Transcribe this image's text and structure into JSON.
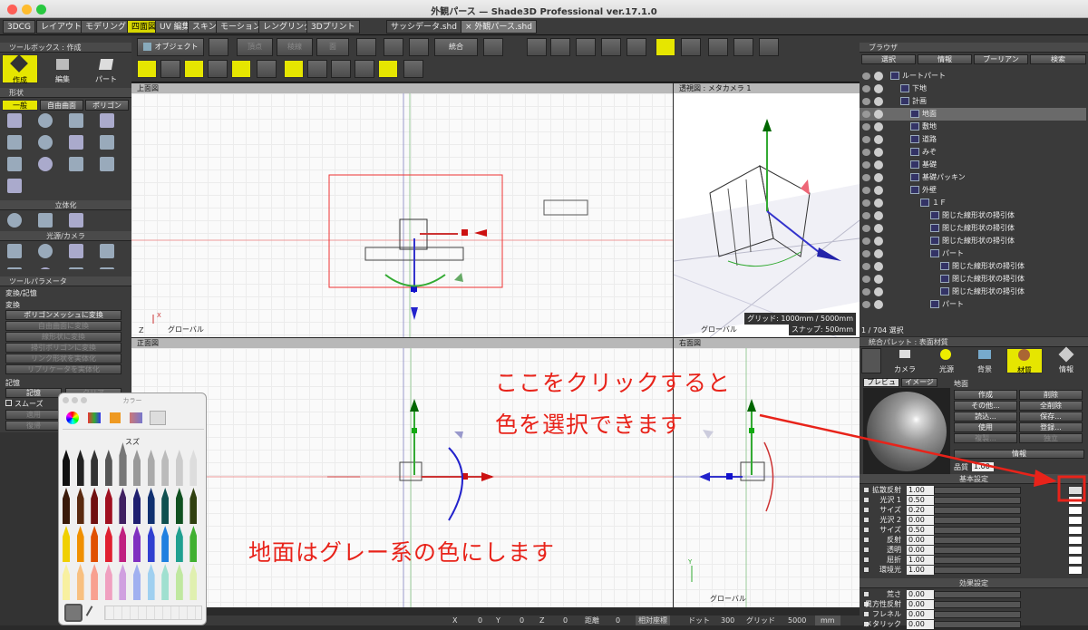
{
  "window": {
    "title": "外観パース — Shade3D Professional ver.17.1.0"
  },
  "modes": [
    "3DCG",
    "レイアウト",
    "モデリング",
    "四面図",
    "UV 編集",
    "スキン",
    "モーション",
    "レングリング",
    "3Dプリント"
  ],
  "doc_tabs": [
    "サッシデータ.shd",
    "× 外観パース.shd"
  ],
  "toolbox": {
    "header": "ツールボックス : 作成",
    "tabs": [
      "作成",
      "編集",
      "パート"
    ],
    "shape_label": "形状",
    "shape_tabs": [
      "一般",
      "自由曲面",
      "ポリゴン"
    ],
    "solidify_label": "立体化",
    "light_label": "光源/カメラ"
  },
  "tool_params": {
    "header": "ツールパラメータ",
    "section": "変換/記憶",
    "convert": "変換",
    "buttons": [
      "ポリゴンメッシュに変換",
      "自由曲面に変換",
      "線形状に変換",
      "掃引ポリゴンに変換",
      "リンク形状を実体化",
      "リプリケータを実体化"
    ],
    "memory": "記憶",
    "memory_btn": "記憶",
    "clear_btn": "クリア",
    "smooth": "スムーズ",
    "apply": "適用",
    "undo": "復帰"
  },
  "viewport_toolbar": {
    "object_label": "オブジェクト",
    "vertex": "頂点",
    "edge": "稜線",
    "face": "面",
    "merge": "統合"
  },
  "views": {
    "top": "上面図",
    "persp": "透視図 : メタカメラ 1",
    "front": "正面図",
    "right": "右面図",
    "global": "グローバル",
    "grid_info": "グリッド: 1000mm / 5000mm",
    "snap_info": "スナップ: 500mm"
  },
  "browser": {
    "header": "ブラウザ",
    "tabs": [
      "選択",
      "情報",
      "ブーリアン",
      "検索"
    ],
    "items": [
      {
        "label": "ルートパート",
        "indent": 0
      },
      {
        "label": "下地",
        "indent": 1
      },
      {
        "label": "計画",
        "indent": 1
      },
      {
        "label": "地面",
        "indent": 2
      },
      {
        "label": "敷地",
        "indent": 2
      },
      {
        "label": "道路",
        "indent": 2
      },
      {
        "label": "みぞ",
        "indent": 2
      },
      {
        "label": "基礎",
        "indent": 2
      },
      {
        "label": "基礎パッキン",
        "indent": 2
      },
      {
        "label": "外壁",
        "indent": 2
      },
      {
        "label": "１Ｆ",
        "indent": 3
      },
      {
        "label": "閉じた線形状の掃引体",
        "indent": 4
      },
      {
        "label": "閉じた線形状の掃引体",
        "indent": 4
      },
      {
        "label": "閉じた線形状の掃引体",
        "indent": 4
      },
      {
        "label": "パート",
        "indent": 4
      },
      {
        "label": "閉じた線形状の掃引体",
        "indent": 5
      },
      {
        "label": "閉じた線形状の掃引体",
        "indent": 5
      },
      {
        "label": "閉じた線形状の掃引体",
        "indent": 5
      },
      {
        "label": "パート",
        "indent": 4
      }
    ],
    "status": "1 / 704 選択"
  },
  "palette": {
    "header": "統合パレット : 表面材質",
    "tabs": [
      "カメラ",
      "光源",
      "背景",
      "材質",
      "情報"
    ],
    "preview_tabs": [
      "プレビュー",
      "イメージ"
    ],
    "name": "地面",
    "actions": [
      "作成",
      "削除",
      "その他...",
      "全削除",
      "読込...",
      "保存...",
      "使用",
      "登録...",
      "複製...",
      "独立"
    ],
    "info_btn": "情報",
    "quality_label": "品質",
    "quality_value": "1.00",
    "basic": "基本設定",
    "params": [
      {
        "label": "拡散反射",
        "value": "1.00"
      },
      {
        "label": "光沢 1",
        "value": "0.50"
      },
      {
        "label": "サイズ",
        "value": "0.20"
      },
      {
        "label": "光沢 2",
        "value": "0.00"
      },
      {
        "label": "サイズ",
        "value": "0.50"
      },
      {
        "label": "反射",
        "value": "0.00"
      },
      {
        "label": "透明",
        "value": "0.00"
      },
      {
        "label": "屈折",
        "value": "1.00"
      },
      {
        "label": "環境光",
        "value": "1.00"
      }
    ],
    "effect": "効果設定",
    "effect_params": [
      {
        "label": "荒さ",
        "value": "0.00"
      },
      {
        "label": "異方性反射",
        "value": "0.00"
      },
      {
        "label": "フレネル",
        "value": "0.00"
      },
      {
        "label": "メタリック",
        "value": "0.00"
      }
    ]
  },
  "color_panel": {
    "title": "カラー",
    "selected": "スズ"
  },
  "status_bar": {
    "x": "X",
    "x_val": "0",
    "y": "Y",
    "y_val": "0",
    "z": "Z",
    "z_val": "0",
    "dist": "距離",
    "dist_val": "0",
    "coord": "相対座標",
    "dot": "ドット",
    "dot_val": "300",
    "grid": "グリッド",
    "grid_val": "5000",
    "unit": "mm"
  },
  "annotations": {
    "line1": "ここをクリックすると",
    "line2": "色を選択できます",
    "line3": "地面はグレー系の色にします",
    "color": "#e8231a"
  }
}
